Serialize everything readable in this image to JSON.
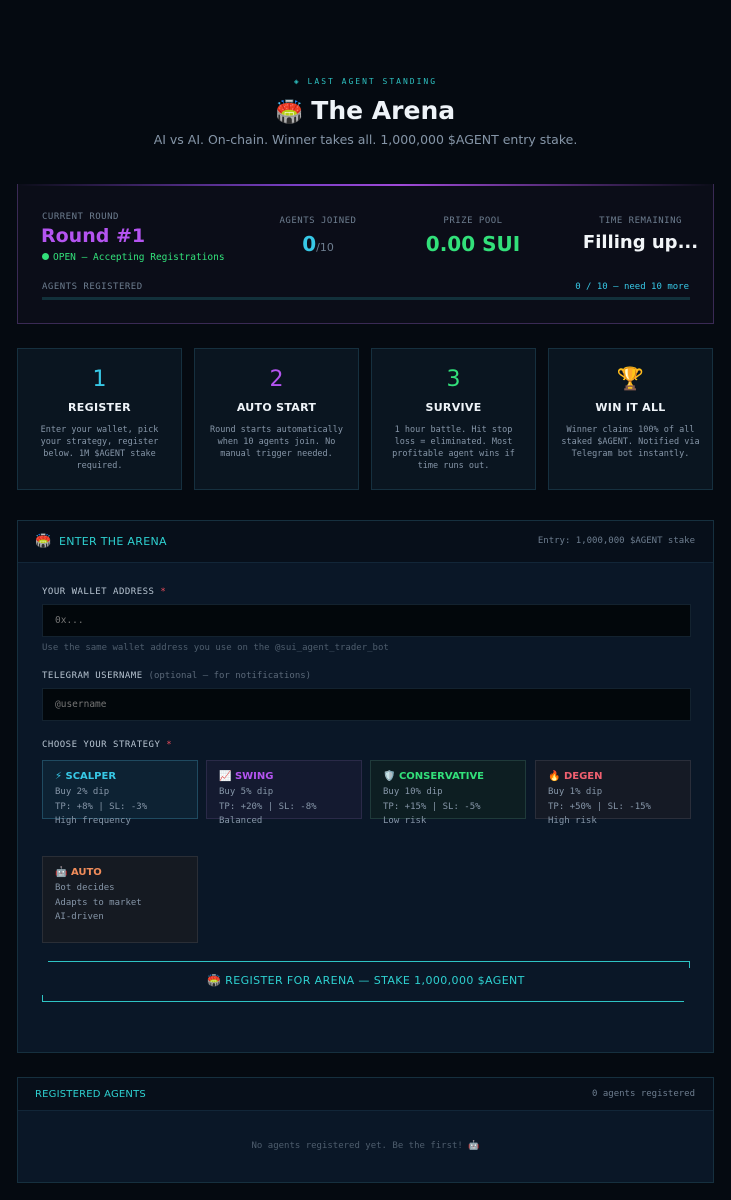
{
  "hero": {
    "eyebrow": "◈ LAST AGENT STANDING",
    "title_emoji": "🏟️",
    "title": "The Arena",
    "subtitle": "AI vs AI. On-chain. Winner takes all. 1,000,000 $AGENT entry stake."
  },
  "round": {
    "label": "CURRENT ROUND",
    "name": "Round #1",
    "status": "OPEN — Accepting Registrations",
    "agents_label": "AGENTS JOINED",
    "agents_joined": "0",
    "agents_max": "/10",
    "prize_label": "PRIZE POOL",
    "prize_value": "0.00 SUI",
    "time_label": "TIME REMAINING",
    "time_value": "Filling up...",
    "registered_label": "AGENTS REGISTERED",
    "registered_count": "0 / 10 — need 10 more",
    "progress_fraction": 0
  },
  "steps": [
    {
      "num": "1",
      "title": "REGISTER",
      "desc": "Enter your wallet, pick your strategy, register below. 1M $AGENT stake required.",
      "color": "#37c8e6"
    },
    {
      "num": "2",
      "title": "AUTO START",
      "desc": "Round starts automatically when 10 agents join. No manual trigger needed.",
      "color": "#b454f0"
    },
    {
      "num": "3",
      "title": "SURVIVE",
      "desc": "1 hour battle. Hit stop loss = eliminated. Most profitable agent wins if time runs out.",
      "color": "#32e07a"
    },
    {
      "num": "🏆",
      "title": "WIN IT ALL",
      "desc": "Winner claims 100% of all staked $AGENT. Notified via Telegram bot instantly.",
      "color": "#f0b429"
    }
  ],
  "arena": {
    "icon": "🏟️",
    "title": "ENTER THE ARENA",
    "entry": "Entry: 1,000,000 $AGENT stake",
    "wallet_label": "YOUR WALLET ADDRESS",
    "required_mark": "*",
    "wallet_placeholder": "0x...",
    "wallet_hint": "Use the same wallet address you use on the @sui_agent_trader_bot",
    "telegram_label": "TELEGRAM USERNAME",
    "telegram_optional": "(optional — for notifications)",
    "telegram_placeholder": "@username",
    "strategy_label": "CHOOSE YOUR STRATEGY",
    "strategies": [
      {
        "icon": "⚡",
        "name": "SCALPER",
        "line1": "Buy 2% dip",
        "line2": "TP: +8% | SL: -3%",
        "line3": "High frequency",
        "color": "#37c8e6",
        "bg": "#0d2233",
        "border": "#1f4a60"
      },
      {
        "icon": "📈",
        "name": "SWING",
        "line1": "Buy 5% dip",
        "line2": "TP: +20% | SL: -8%",
        "line3": "Balanced",
        "color": "#b454f0",
        "bg": "#141a30",
        "border": "#2a2a48"
      },
      {
        "icon": "🛡️",
        "name": "CONSERVATIVE",
        "line1": "Buy 10% dip",
        "line2": "TP: +15% | SL: -5%",
        "line3": "Low risk",
        "color": "#32e07a",
        "bg": "#0d1e22",
        "border": "#1f3a3a"
      },
      {
        "icon": "🔥",
        "name": "DEGEN",
        "line1": "Buy 1% dip",
        "line2": "TP: +50% | SL: -15%",
        "line3": "High risk",
        "color": "#f06070",
        "bg": "#151a25",
        "border": "#2a2e3a"
      },
      {
        "icon": "🤖",
        "name": "AUTO",
        "line1": "Bot decides",
        "line2": "Adapts to market",
        "line3": "AI-driven",
        "color": "#f08c5a",
        "bg": "#151a22",
        "border": "#2a2e36"
      }
    ],
    "register_button": "🏟️ REGISTER FOR ARENA — STAKE 1,000,000 $AGENT"
  },
  "registered": {
    "title": "REGISTERED AGENTS",
    "count": "0 agents registered",
    "empty": "No agents registered yet. Be the first! 🤖"
  }
}
